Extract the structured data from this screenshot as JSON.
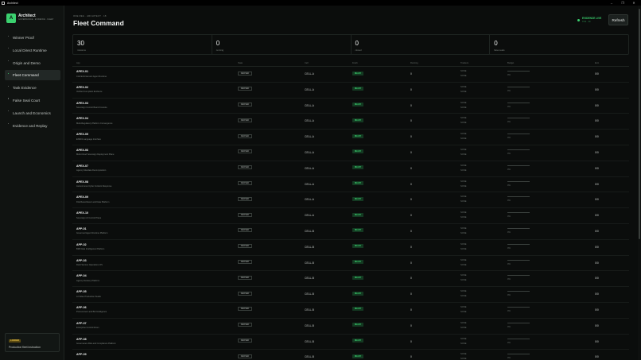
{
  "window": {
    "title": "Architect",
    "min": "–",
    "max": "❐",
    "close": "✕"
  },
  "brand": {
    "name": "Architect",
    "subtitle": "GOVERNANCE · EVIDENCE · FLEET",
    "logo_glyph": "A",
    "accent": "#3bd16f"
  },
  "nav": [
    {
      "label": "Winner Proof",
      "active": false
    },
    {
      "label": "Local Direct Runtime",
      "active": false
    },
    {
      "label": "Origin and Demo",
      "active": false
    },
    {
      "label": "Fleet Command",
      "active": true
    },
    {
      "label": "Task Evidence",
      "active": false
    },
    {
      "label": "False Seal Court",
      "active": false
    },
    {
      "label": "Launch and Economics",
      "active": false
    },
    {
      "label": "Evidence and Replay",
      "active": false
    }
  ],
  "sidebar_card": {
    "badge": "LOCKED",
    "text": "Production fleet instruction"
  },
  "header": {
    "breadcrumb": "ONE REG · ARCHITECT · 18",
    "title": "Fleet Command",
    "evidence_title": "EVIDENCE LIVE",
    "evidence_sub": "TOS · 30",
    "refresh": "Refresh"
  },
  "stats": [
    {
      "value": "30",
      "label": "missions"
    },
    {
      "value": "0",
      "label": "running"
    },
    {
      "value": "0",
      "label": "closed"
    },
    {
      "value": "0",
      "label": "false seals"
    }
  ],
  "columns": [
    "App",
    "State",
    "Cell",
    "Fresh",
    "Running",
    "Trackers",
    "Budget",
    "Ev/n"
  ],
  "rows": [
    {
      "name": "APEX-01",
      "desc": "Civil Enforcement Agent Runtime",
      "state": "DEFINED",
      "cell": "CELL-A",
      "fresh": "READY",
      "running": "0",
      "tr1": "NONE",
      "tr2": "NONE",
      "pct": "0%",
      "evidence": "0/0"
    },
    {
      "name": "APEX-02",
      "desc": "Verified Compliant Evidence",
      "state": "DEFINED",
      "cell": "CELL-A",
      "fresh": "READY",
      "running": "0",
      "tr1": "NONE",
      "tr2": "NONE",
      "pct": "0%",
      "evidence": "0/0"
    },
    {
      "name": "APEX-03",
      "desc": "Sovereign Control Board Console",
      "state": "DEFINED",
      "cell": "CELL-A",
      "fresh": "READY",
      "running": "0",
      "tr1": "NONE",
      "tr2": "NONE",
      "pct": "0%",
      "evidence": "0/0"
    },
    {
      "name": "APEX-04",
      "desc": "Multi-Regulatory Platform Convergence",
      "state": "DEFINED",
      "cell": "CELL-A",
      "fresh": "READY",
      "running": "0",
      "tr1": "NONE",
      "tr2": "NONE",
      "pct": "0%",
      "evidence": "0/0"
    },
    {
      "name": "APEX-05",
      "desc": "EN301 Language Interface",
      "state": "DEFINED",
      "cell": "CELL-A",
      "fresh": "READY",
      "running": "0",
      "tr1": "NONE",
      "tr2": "NONE",
      "pct": "0%",
      "evidence": "0/0"
    },
    {
      "name": "APEX-06",
      "desc": "Multi-Cloud Sovereign Deployment Plane",
      "state": "DEFINED",
      "cell": "CELL-A",
      "fresh": "READY",
      "running": "0",
      "tr1": "NONE",
      "tr2": "NONE",
      "pct": "0%",
      "evidence": "0/0"
    },
    {
      "name": "APEX-07",
      "desc": "Agency Mandate Decomposition",
      "state": "DEFINED",
      "cell": "CELL-A",
      "fresh": "READY",
      "running": "0",
      "tr1": "NONE",
      "tr2": "NONE",
      "pct": "0%",
      "evidence": "0/0"
    },
    {
      "name": "APEX-08",
      "desc": "Autonomous Cyber Incident Response",
      "state": "DEFINED",
      "cell": "CELL-A",
      "fresh": "READY",
      "running": "0",
      "tr1": "NONE",
      "tr2": "NONE",
      "pct": "0%",
      "evidence": "0/0"
    },
    {
      "name": "APEX-09",
      "desc": "Distributed Event and Data Platform",
      "state": "DEFINED",
      "cell": "CELL-A",
      "fresh": "READY",
      "running": "0",
      "tr1": "NONE",
      "tr2": "NONE",
      "pct": "0%",
      "evidence": "0/0"
    },
    {
      "name": "APEX-10",
      "desc": "Sovereign AI Control Plane",
      "state": "DEFINED",
      "cell": "CELL-A",
      "fresh": "READY",
      "running": "0",
      "tr1": "NONE",
      "tr2": "NONE",
      "pct": "0%",
      "evidence": "0/0"
    },
    {
      "name": "APP-01",
      "desc": "Governed Agent Runtime Platform",
      "state": "DEFINED",
      "cell": "CELL-B",
      "fresh": "READY",
      "running": "0",
      "tr1": "NONE",
      "tr2": "NONE",
      "pct": "0%",
      "evidence": "0/0"
    },
    {
      "name": "APP-02",
      "desc": "B2B Data Intelligence Platform",
      "state": "DEFINED",
      "cell": "CELL-B",
      "fresh": "READY",
      "running": "0",
      "tr1": "NONE",
      "tr2": "NONE",
      "pct": "0%",
      "evidence": "0/0"
    },
    {
      "name": "APP-03",
      "desc": "Field Service Operations OS",
      "state": "DEFINED",
      "cell": "CELL-B",
      "fresh": "READY",
      "running": "0",
      "tr1": "NONE",
      "tr2": "NONE",
      "pct": "0%",
      "evidence": "0/0"
    },
    {
      "name": "APP-04",
      "desc": "Agency Delivery Platform",
      "state": "DEFINED",
      "cell": "CELL-B",
      "fresh": "READY",
      "running": "0",
      "tr1": "NONE",
      "tr2": "NONE",
      "pct": "0%",
      "evidence": "0/0"
    },
    {
      "name": "APP-05",
      "desc": "AI Video Production Studio",
      "state": "DEFINED",
      "cell": "CELL-B",
      "fresh": "READY",
      "running": "0",
      "tr1": "NONE",
      "tr2": "NONE",
      "pct": "0%",
      "evidence": "0/0"
    },
    {
      "name": "APP-06",
      "desc": "Procurement and Bid Intelligence",
      "state": "DEFINED",
      "cell": "CELL-B",
      "fresh": "READY",
      "running": "0",
      "tr1": "NONE",
      "tr2": "NONE",
      "pct": "0%",
      "evidence": "0/0"
    },
    {
      "name": "APP-07",
      "desc": "Enterprise Control Room",
      "state": "DEFINED",
      "cell": "CELL-B",
      "fresh": "READY",
      "running": "0",
      "tr1": "NONE",
      "tr2": "NONE",
      "pct": "0%",
      "evidence": "0/0"
    },
    {
      "name": "APP-08",
      "desc": "Governance Risk and Compliance Platform",
      "state": "DEFINED",
      "cell": "CELL-B",
      "fresh": "READY",
      "running": "0",
      "tr1": "NONE",
      "tr2": "NONE",
      "pct": "0%",
      "evidence": "0/0"
    },
    {
      "name": "APP-09",
      "desc": "",
      "state": "DEFINED",
      "cell": "CELL-B",
      "fresh": "READY",
      "running": "0",
      "tr1": "NONE",
      "tr2": "NONE",
      "pct": "0%",
      "evidence": "0/0"
    }
  ]
}
